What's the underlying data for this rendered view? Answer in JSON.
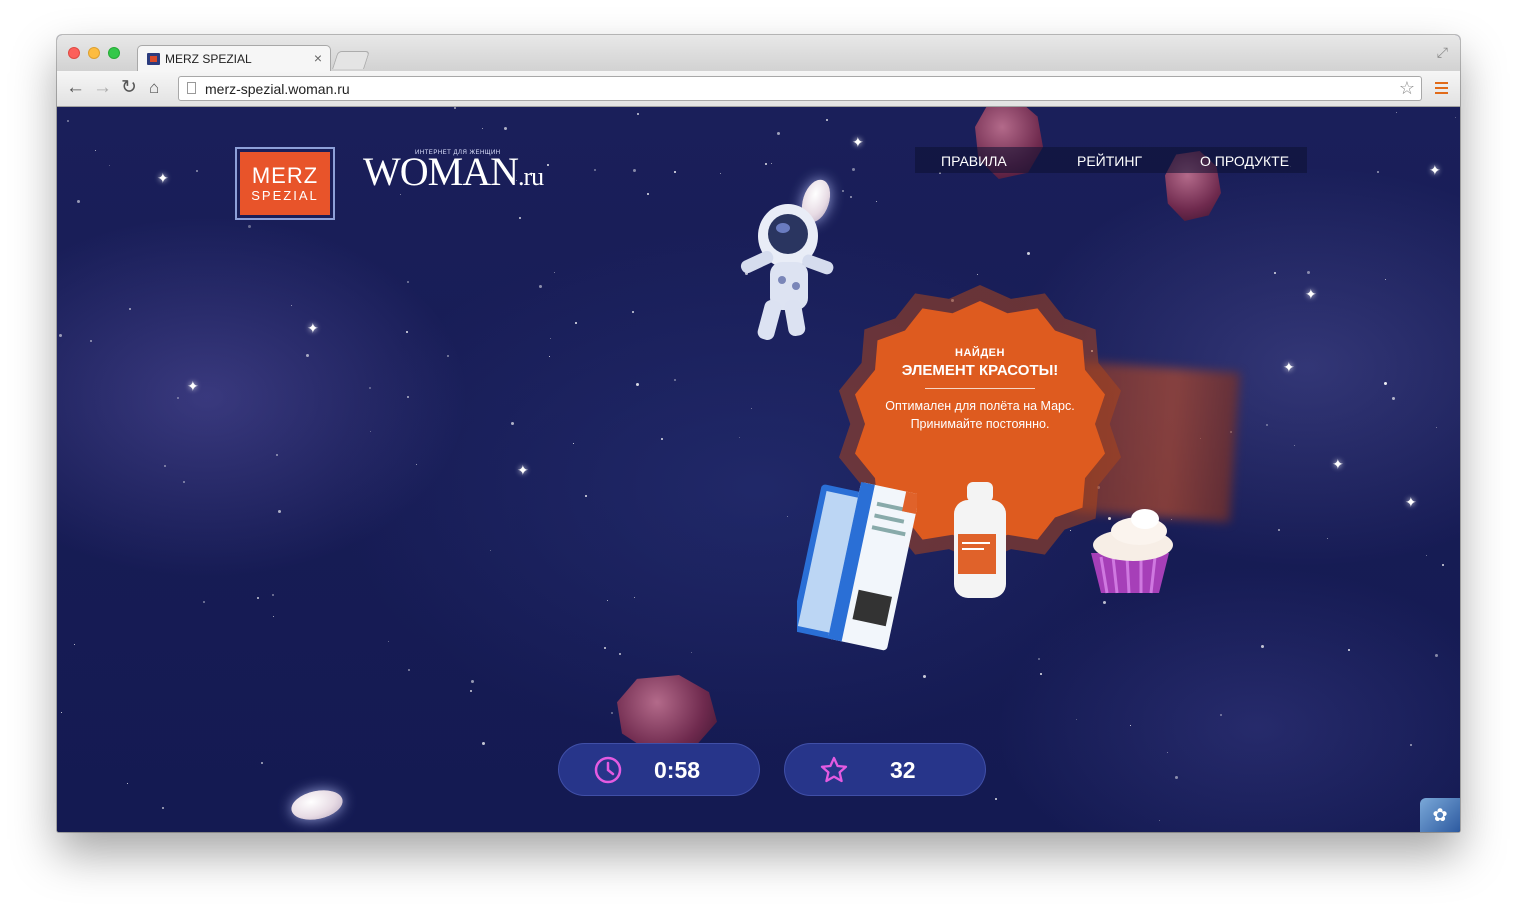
{
  "browser": {
    "tab_title": "MERZ SPEZIAL",
    "tab_close": "×",
    "url": "merz-spezial.woman.ru",
    "back": "←",
    "forward": "→",
    "reload": "↻",
    "home": "⌂",
    "star": "☆",
    "fullscreen": "⤢"
  },
  "logos": {
    "merz_line1": "MERZ",
    "merz_line2": "SPEZIAL",
    "woman_tagline": "ИНТЕРНЕТ ДЛЯ ЖЕНЩИН",
    "woman_main": "WOMAN",
    "woman_suffix": ".ru"
  },
  "nav": {
    "rules": "ПРАВИЛА",
    "rating": "РЕЙТИНГ",
    "product": "О ПРОДУКТЕ"
  },
  "popup": {
    "found": "НАЙДЕН",
    "title": "ЭЛЕМЕНТ КРАСОТЫ!",
    "desc_line1": "Оптимален для полёта на Марс.",
    "desc_line2": "Принимайте постоянно."
  },
  "hud": {
    "timer_icon": "clock-icon",
    "timer_value": "0:58",
    "score_icon": "star-icon",
    "score_value": "32"
  },
  "colors": {
    "background": "#191f58",
    "accent_orange": "#de5b1f",
    "hud_bg": "#27358a",
    "icon_pink": "#e45be1"
  }
}
